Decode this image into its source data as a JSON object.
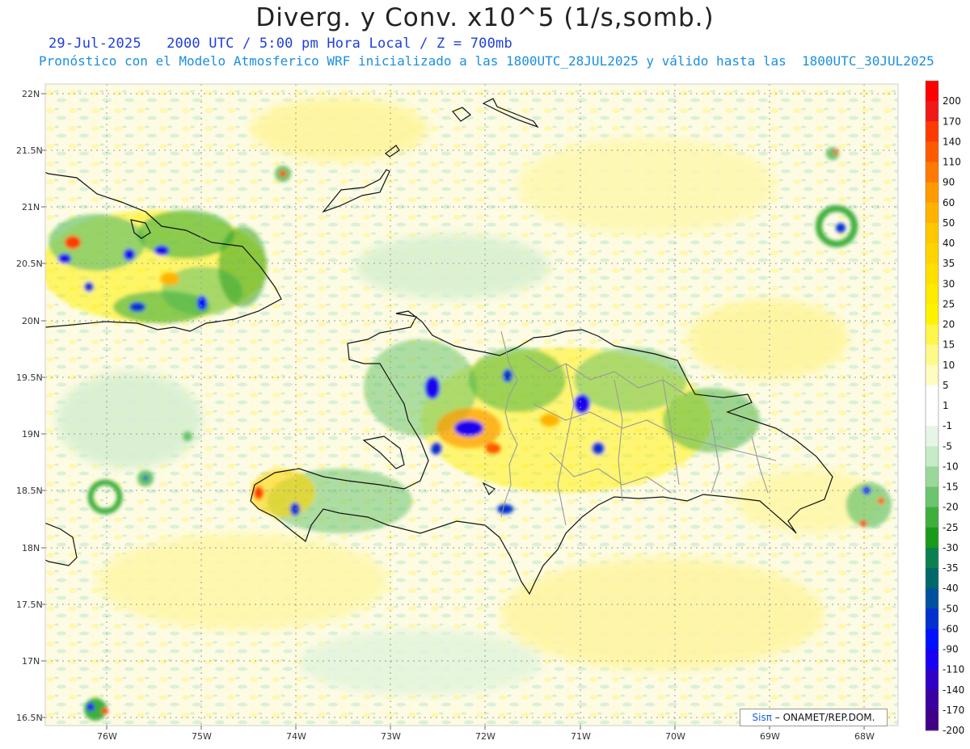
{
  "title": "Diverg. y Conv. x10^5 (1/s,somb.)",
  "subtitle_line1": "29-Jul-2025   2000 UTC / 5:00 pm Hora Local / Z = 700mb",
  "subtitle_line2": "Pronóstico con el Modelo Atmosferico WRF inicializado a las 1800UTC_28JUL2025 y válido hasta las  1800UTC_30JUL2025",
  "lat_labels": [
    "22N",
    "21.5N",
    "21N",
    "20.5N",
    "20N",
    "19.5N",
    "19N",
    "18.5N",
    "18N",
    "17.5N",
    "17N",
    "16.5N"
  ],
  "lon_labels": [
    "76W",
    "75W",
    "74W",
    "73W",
    "72W",
    "71W",
    "70W",
    "69W",
    "68W"
  ],
  "colorbar": {
    "labels": [
      "200",
      "170",
      "140",
      "110",
      "90",
      "60",
      "50",
      "40",
      "35",
      "30",
      "25",
      "20",
      "15",
      "10",
      "5",
      "1",
      "-1",
      "-5",
      "-10",
      "-15",
      "-20",
      "-25",
      "-30",
      "-35",
      "-40",
      "-50",
      "-60",
      "-90",
      "-110",
      "-140",
      "-170",
      "-200"
    ],
    "colors": [
      "#ff0000",
      "#f01818",
      "#ff3a00",
      "#ff5a00",
      "#ff7a00",
      "#ff9a00",
      "#ffb300",
      "#ffc800",
      "#ffd400",
      "#ffe000",
      "#ffea00",
      "#fff200",
      "#fff64a",
      "#fffa88",
      "#fffcc0",
      "#ffffff",
      "#ffffff",
      "#e6f5e6",
      "#c6ebc6",
      "#9ad89a",
      "#6cc46c",
      "#3daf3d",
      "#1a9a1a",
      "#0a8050",
      "#006868",
      "#0050a0",
      "#0030d0",
      "#0010ff",
      "#1a00f0",
      "#3000c8",
      "#3a00a0",
      "#400088"
    ]
  },
  "credit_brand": "Sisπ",
  "credit_text": " – ONAMET/REP.DOM."
}
